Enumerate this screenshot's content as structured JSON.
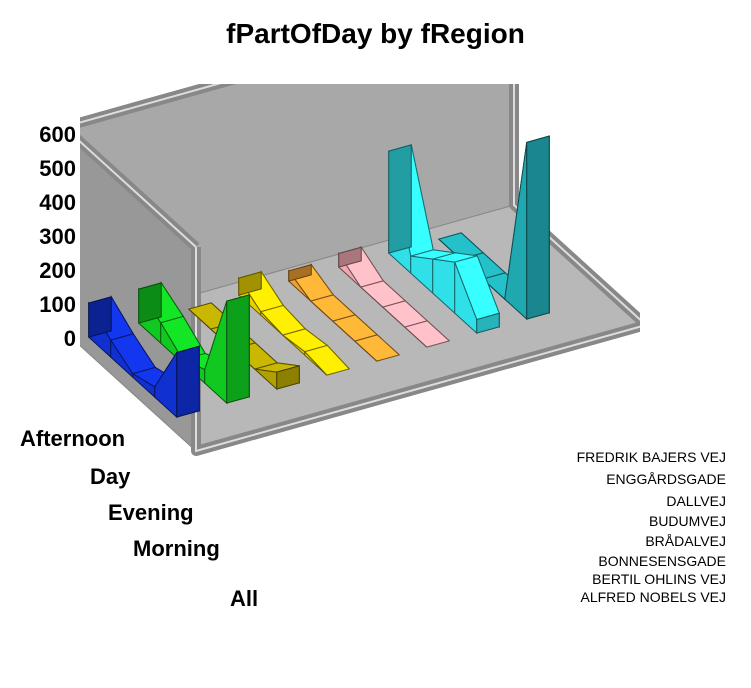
{
  "chart_data": {
    "type": "area",
    "title": "fPartOfDay by fRegion",
    "categories": [
      "Afternoon",
      "Day",
      "Evening",
      "Morning",
      "All"
    ],
    "y_ticks": [
      0,
      100,
      200,
      300,
      400,
      500,
      600
    ],
    "ylim": [
      0,
      600
    ],
    "region_labels": [
      "ALFRED NOBELS VEJ",
      "BERTIL OHLINS VEJ",
      "BONNESENSGADE",
      "BRÅDALVEJ",
      "BUDUMVEJ",
      "DALLVEJ",
      "ENGGÅRDSGADE",
      "FREDRIK BAJERS VEJ"
    ],
    "series": [
      {
        "name": "ALFRED NOBELS VEJ",
        "color": "#1030D0",
        "values": [
          100,
          50,
          10,
          30,
          190
        ]
      },
      {
        "name": "BERTIL OHLINS VEJ",
        "color": "#10C820",
        "values": [
          100,
          60,
          10,
          40,
          300
        ]
      },
      {
        "name": "BONNESENSGADE",
        "color": "#B0A000",
        "values": [
          0,
          0,
          0,
          0,
          50
        ]
      },
      {
        "name": "BRÅDALVEJ",
        "color": "#E8D000",
        "values": [
          50,
          10,
          0,
          10,
          0
        ]
      },
      {
        "name": "BUDUMVEJ",
        "color": "#F0A030",
        "values": [
          30,
          0,
          0,
          0,
          0
        ]
      },
      {
        "name": "DALLVEJ",
        "color": "#F0A8B0",
        "values": [
          40,
          0,
          0,
          0,
          0
        ]
      },
      {
        "name": "ENGGÅRDSGADE",
        "color": "#30E0E8",
        "values": [
          300,
          50,
          100,
          150,
          40
        ]
      },
      {
        "name": "FREDRIK BAJERS VEJ",
        "color": "#20A8B0",
        "values": [
          0,
          0,
          0,
          0,
          520
        ]
      }
    ]
  }
}
